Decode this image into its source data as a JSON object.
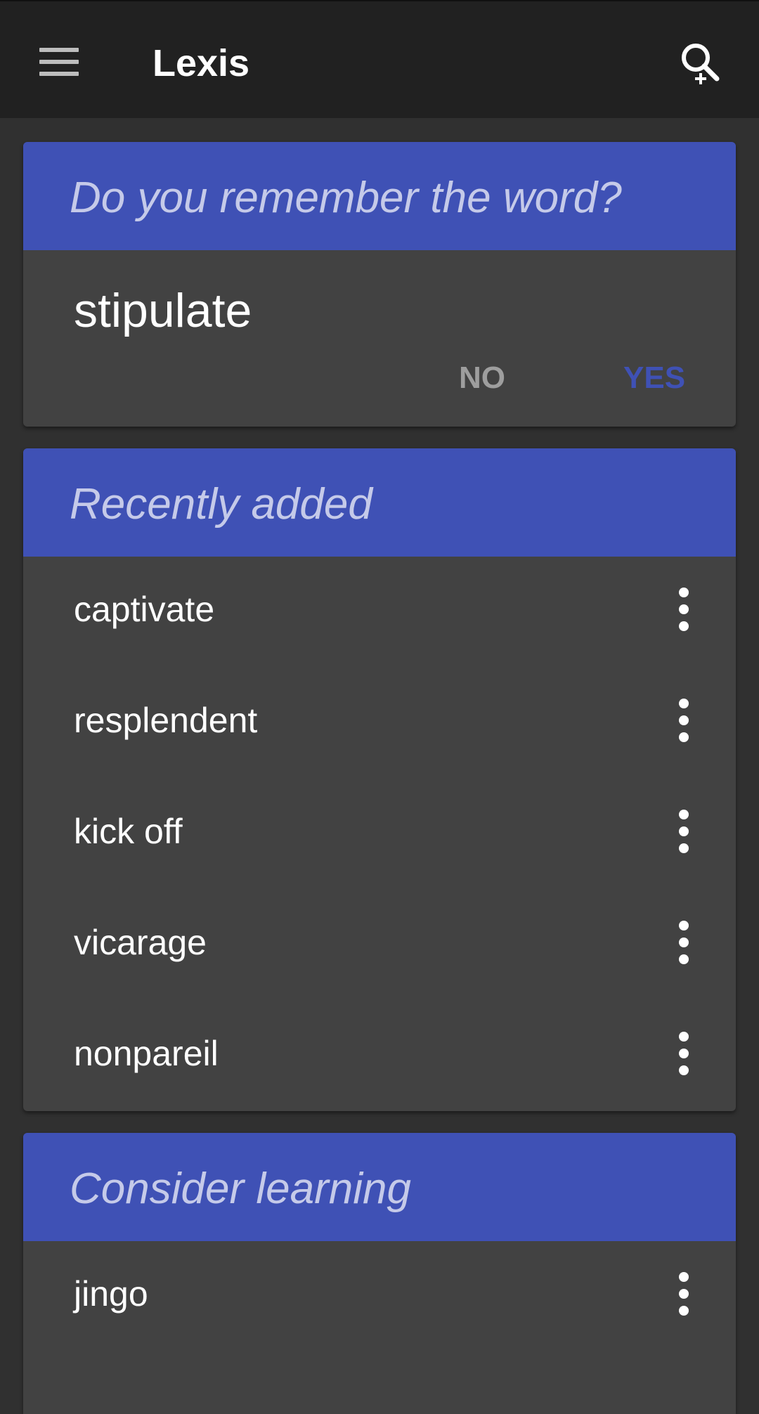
{
  "appbar": {
    "title": "Lexis",
    "menu_icon": "hamburger-menu-icon",
    "search_icon": "search-add-icon"
  },
  "review_card": {
    "title": "Do you remember the word?",
    "word": "stipulate",
    "no_label": "NO",
    "yes_label": "YES"
  },
  "recent_card": {
    "title": "Recently added",
    "items": [
      {
        "label": "captivate"
      },
      {
        "label": "resplendent"
      },
      {
        "label": "kick off"
      },
      {
        "label": "vicarage"
      },
      {
        "label": "nonpareil"
      }
    ]
  },
  "consider_card": {
    "title": "Consider learning",
    "items": [
      {
        "label": "jingo"
      }
    ]
  },
  "colors": {
    "accent": "#3f51b5",
    "header_text": "#c5cae9",
    "card_bg": "#424242",
    "page_bg": "#303030",
    "appbar_bg": "#212121"
  }
}
